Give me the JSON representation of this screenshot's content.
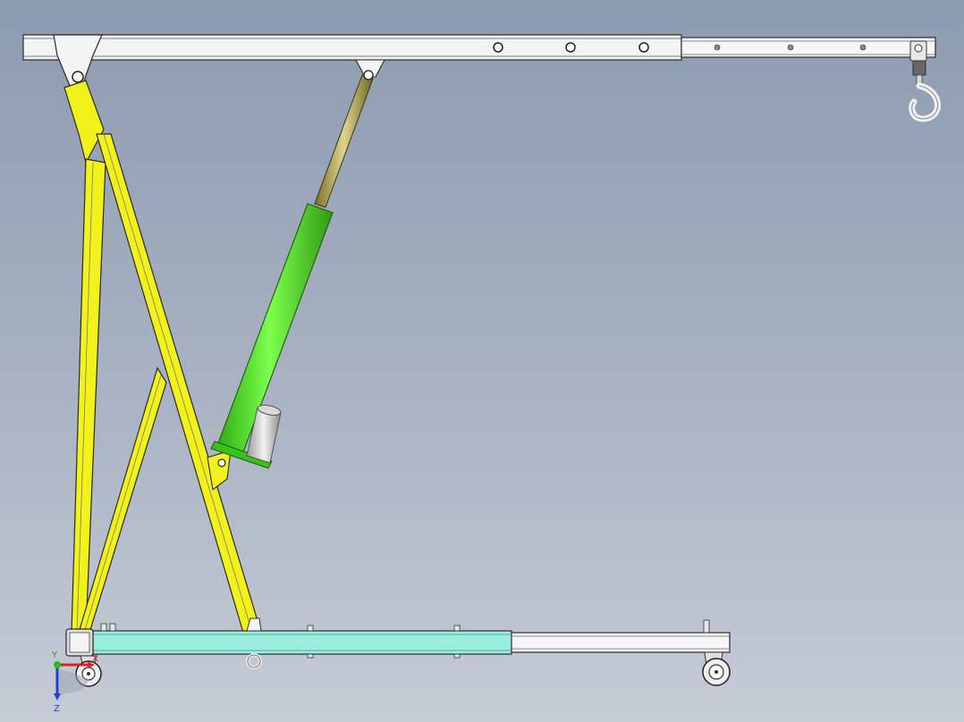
{
  "viewport": {
    "background_top": "#8d9bb0",
    "background_bottom": "#c6ccd6"
  },
  "colors": {
    "frame_yellow": "#f2f21a",
    "cylinder_green": "#4ee61f",
    "rod_olive": "#b9ad52",
    "base_leg_cyan": "#9aeee0",
    "boom_white": "#f4f4f4",
    "outline": "#2a2a2a"
  },
  "triad": {
    "x_label": "X",
    "y_label": "Y",
    "z_label": "Z",
    "x_color": "#e02020",
    "y_color": "#20c020",
    "z_color": "#2040d0"
  },
  "components": [
    "boom",
    "boom-extension",
    "lifting-hook",
    "mast",
    "brace",
    "hydraulic-cylinder",
    "piston-rod",
    "base-leg",
    "base-leg-extension",
    "caster-wheel"
  ]
}
